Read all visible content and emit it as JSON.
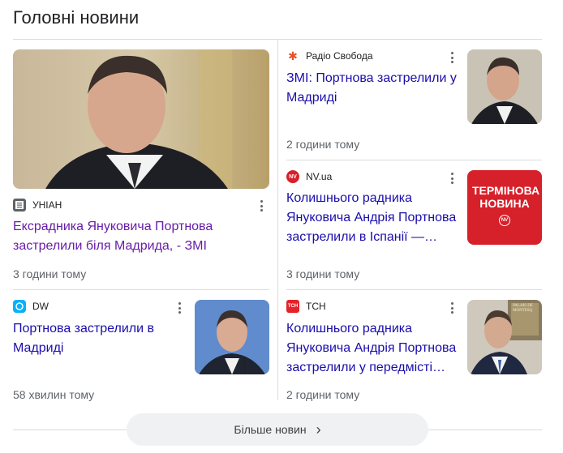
{
  "section_title": "Головні новини",
  "articles": [
    {
      "source": "УНІАН",
      "headline": "Ексрадника Януковича Портнова застрелили біля Мадрида, - ЗМІ",
      "time": "3 години тому"
    },
    {
      "source": "Радіо Свобода",
      "headline": "ЗМІ: Портнова застрелили у Мадриді",
      "time": "2 години тому"
    },
    {
      "source": "NV.ua",
      "headline": "Колишнього радника Януковича Андрія Портнова застрелили в Іспанії —…",
      "time": "3 години тому",
      "thumb_text": "ТЕРМІНОВА НОВИНА",
      "logo_text": "NV"
    },
    {
      "source": "DW",
      "headline": "Портнова застрелили в Мадриді",
      "time": "58 хвилин тому"
    },
    {
      "source": "TCH",
      "headline": "Колишнього радника Януковича Андрія Портнова застрелили у передмісті…",
      "time": "2 години тому",
      "logo_text": "ТСН",
      "thumb_text": "PALAIS DE MONTESQ"
    }
  ],
  "more_button": "Більше новин",
  "colors": {
    "link": "#1a0dab",
    "visited": "#681da8",
    "nv_red": "#d6202a",
    "tsn_red": "#e32229"
  }
}
